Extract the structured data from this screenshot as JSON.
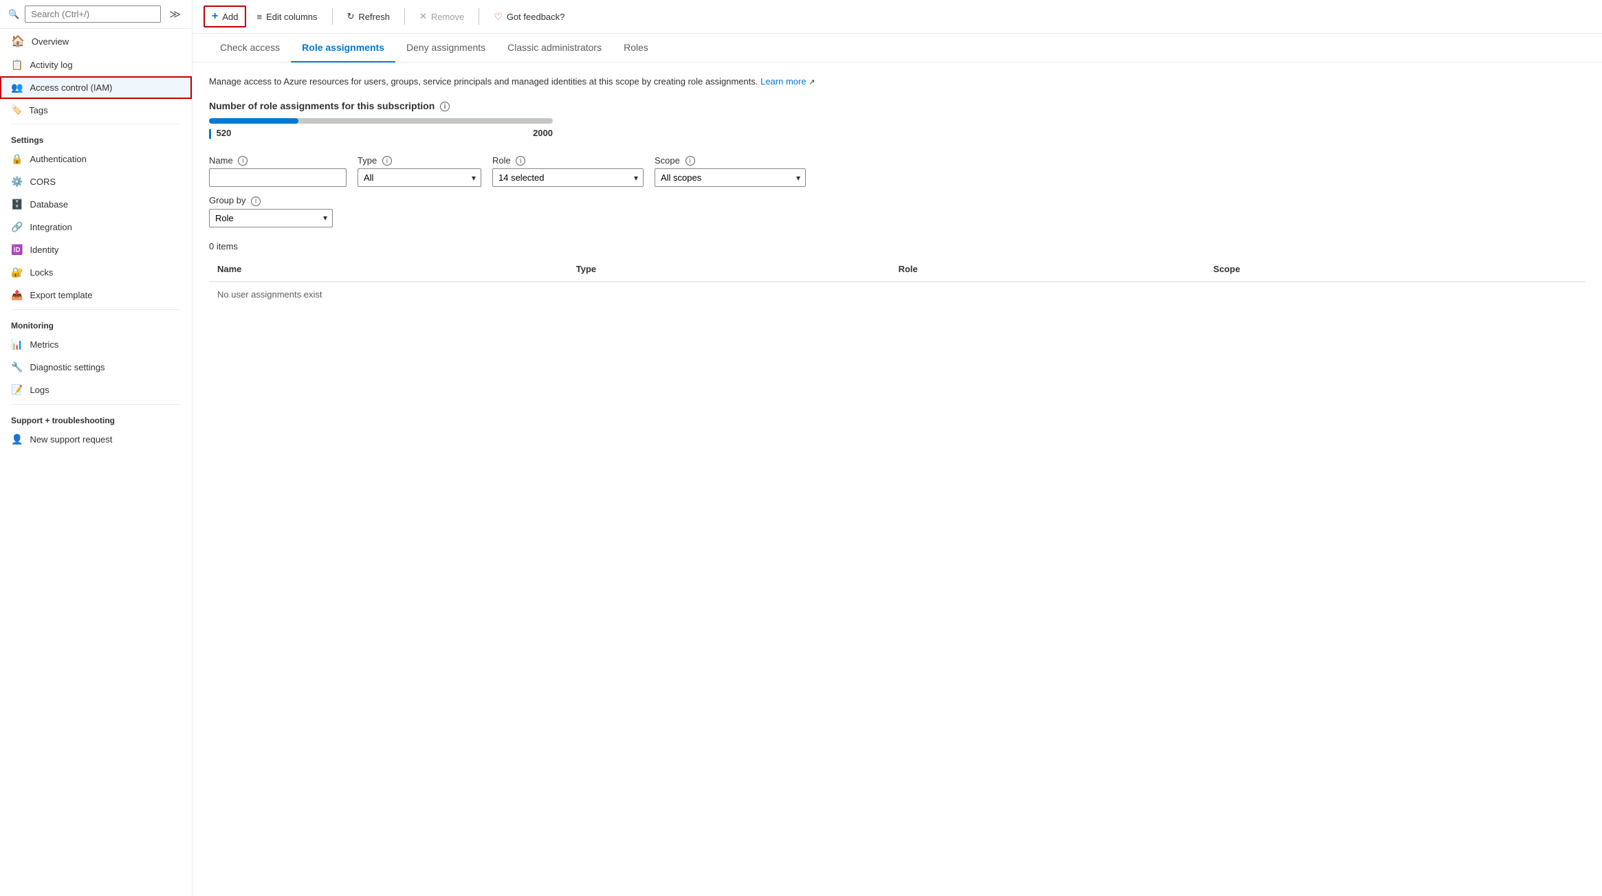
{
  "sidebar": {
    "search": {
      "placeholder": "Search (Ctrl+/)"
    },
    "nav_items": [
      {
        "id": "overview",
        "label": "Overview",
        "icon": "overview",
        "active": false
      },
      {
        "id": "activity-log",
        "label": "Activity log",
        "icon": "activity",
        "active": false
      },
      {
        "id": "access-control",
        "label": "Access control (IAM)",
        "icon": "iam",
        "active": true
      }
    ],
    "tags_item": {
      "label": "Tags",
      "icon": "tags"
    },
    "settings_section": "Settings",
    "settings_items": [
      {
        "id": "authentication",
        "label": "Authentication",
        "icon": "auth"
      },
      {
        "id": "cors",
        "label": "CORS",
        "icon": "cors"
      },
      {
        "id": "database",
        "label": "Database",
        "icon": "db"
      },
      {
        "id": "integration",
        "label": "Integration",
        "icon": "integration"
      },
      {
        "id": "identity",
        "label": "Identity",
        "icon": "identity"
      },
      {
        "id": "locks",
        "label": "Locks",
        "icon": "locks"
      },
      {
        "id": "export-template",
        "label": "Export template",
        "icon": "export"
      }
    ],
    "monitoring_section": "Monitoring",
    "monitoring_items": [
      {
        "id": "metrics",
        "label": "Metrics",
        "icon": "metrics"
      },
      {
        "id": "diagnostic",
        "label": "Diagnostic settings",
        "icon": "diagnostic"
      },
      {
        "id": "logs",
        "label": "Logs",
        "icon": "logs"
      }
    ],
    "support_section": "Support + troubleshooting",
    "support_items": [
      {
        "id": "new-support",
        "label": "New support request",
        "icon": "support"
      }
    ]
  },
  "toolbar": {
    "add_label": "Add",
    "edit_columns_label": "Edit columns",
    "refresh_label": "Refresh",
    "remove_label": "Remove",
    "feedback_label": "Got feedback?"
  },
  "tabs": [
    {
      "id": "check-access",
      "label": "Check access",
      "active": false
    },
    {
      "id": "role-assignments",
      "label": "Role assignments",
      "active": true
    },
    {
      "id": "deny-assignments",
      "label": "Deny assignments",
      "active": false
    },
    {
      "id": "classic-admins",
      "label": "Classic administrators",
      "active": false
    },
    {
      "id": "roles",
      "label": "Roles",
      "active": false
    }
  ],
  "content": {
    "description": "Manage access to Azure resources for users, groups, service principals and managed identities at this scope by creating role assignments.",
    "learn_more": "Learn more",
    "section_title": "Number of role assignments for this subscription",
    "progress": {
      "current": "520",
      "max": "2000",
      "percentage": 26
    },
    "filters": {
      "name_label": "Name",
      "name_placeholder": "",
      "type_label": "Type",
      "type_value": "All",
      "role_label": "Role",
      "role_value": "14 selected",
      "scope_label": "Scope",
      "scope_value": "All scopes",
      "group_by_label": "Group by",
      "group_by_value": "Role"
    },
    "table": {
      "item_count": "0 items",
      "columns": [
        {
          "label": "Name"
        },
        {
          "label": "Type"
        },
        {
          "label": "Role"
        },
        {
          "label": "Scope"
        }
      ],
      "empty_message": "No user assignments exist"
    }
  }
}
